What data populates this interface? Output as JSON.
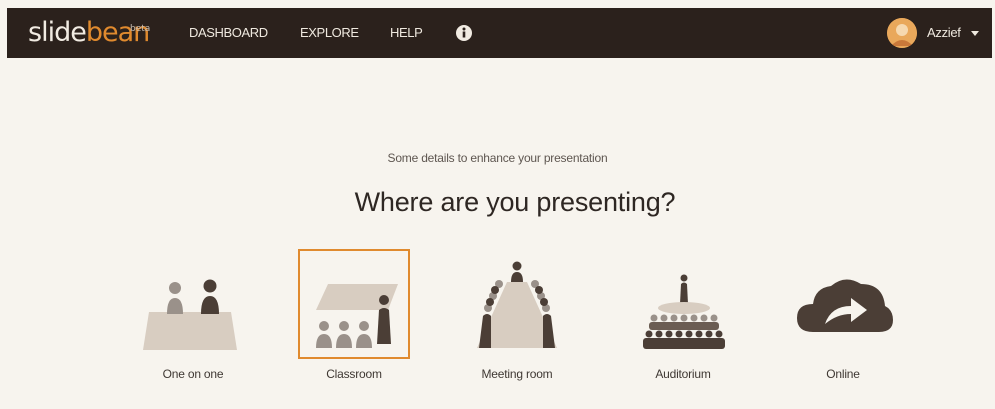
{
  "app": {
    "logo_text_main": "slide",
    "logo_text_accent": "bean",
    "logo_badge": "beta"
  },
  "nav": {
    "items": [
      {
        "label": "DASHBOARD"
      },
      {
        "label": "EXPLORE"
      },
      {
        "label": "HELP"
      }
    ],
    "info_icon": "info-circle-icon"
  },
  "user": {
    "name": "Azzief",
    "menu_icon": "caret-down-icon"
  },
  "main": {
    "subtitle": "Some details to enhance your presentation",
    "title": "Where are you presenting?",
    "options": [
      {
        "label": "One on one",
        "icon": "one-on-one-icon",
        "selected": false
      },
      {
        "label": "Classroom",
        "icon": "classroom-icon",
        "selected": true
      },
      {
        "label": "Meeting room",
        "icon": "meeting-room-icon",
        "selected": false
      },
      {
        "label": "Auditorium",
        "icon": "auditorium-icon",
        "selected": false
      },
      {
        "label": "Online",
        "icon": "cloud-share-icon",
        "selected": false
      }
    ]
  },
  "colors": {
    "navbar": "#2b211c",
    "accent": "#e08a2e",
    "background": "#f7f4ee",
    "figure_dark": "#4b3e36",
    "figure_light": "#9a918a",
    "table": "#d8cdc1"
  }
}
